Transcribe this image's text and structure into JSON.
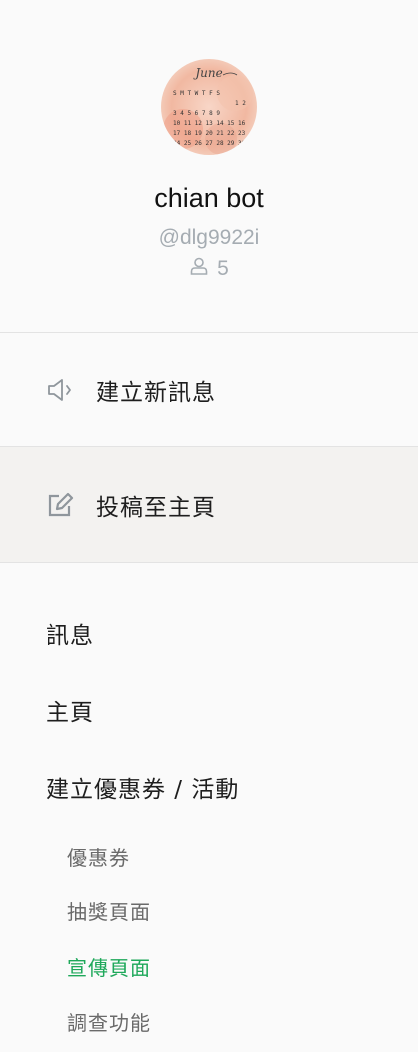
{
  "profile": {
    "avatar_text": "June",
    "name": "chian bot",
    "id": "@dlg9922i",
    "friend_count": "5",
    "friend_icon": "person-icon"
  },
  "actions": [
    {
      "label": "建立新訊息",
      "icon": "megaphone-icon"
    },
    {
      "label": "投稿至主頁",
      "icon": "edit-icon"
    }
  ],
  "nav": {
    "items": [
      {
        "label": "訊息"
      },
      {
        "label": "主頁"
      },
      {
        "label": "建立優惠券 / 活動"
      }
    ],
    "sub_items": [
      {
        "label": "優惠券"
      },
      {
        "label": "抽獎頁面"
      },
      {
        "label": "宣傳頁面"
      },
      {
        "label": "調查功能"
      }
    ],
    "active_color": "#1ea85a"
  }
}
